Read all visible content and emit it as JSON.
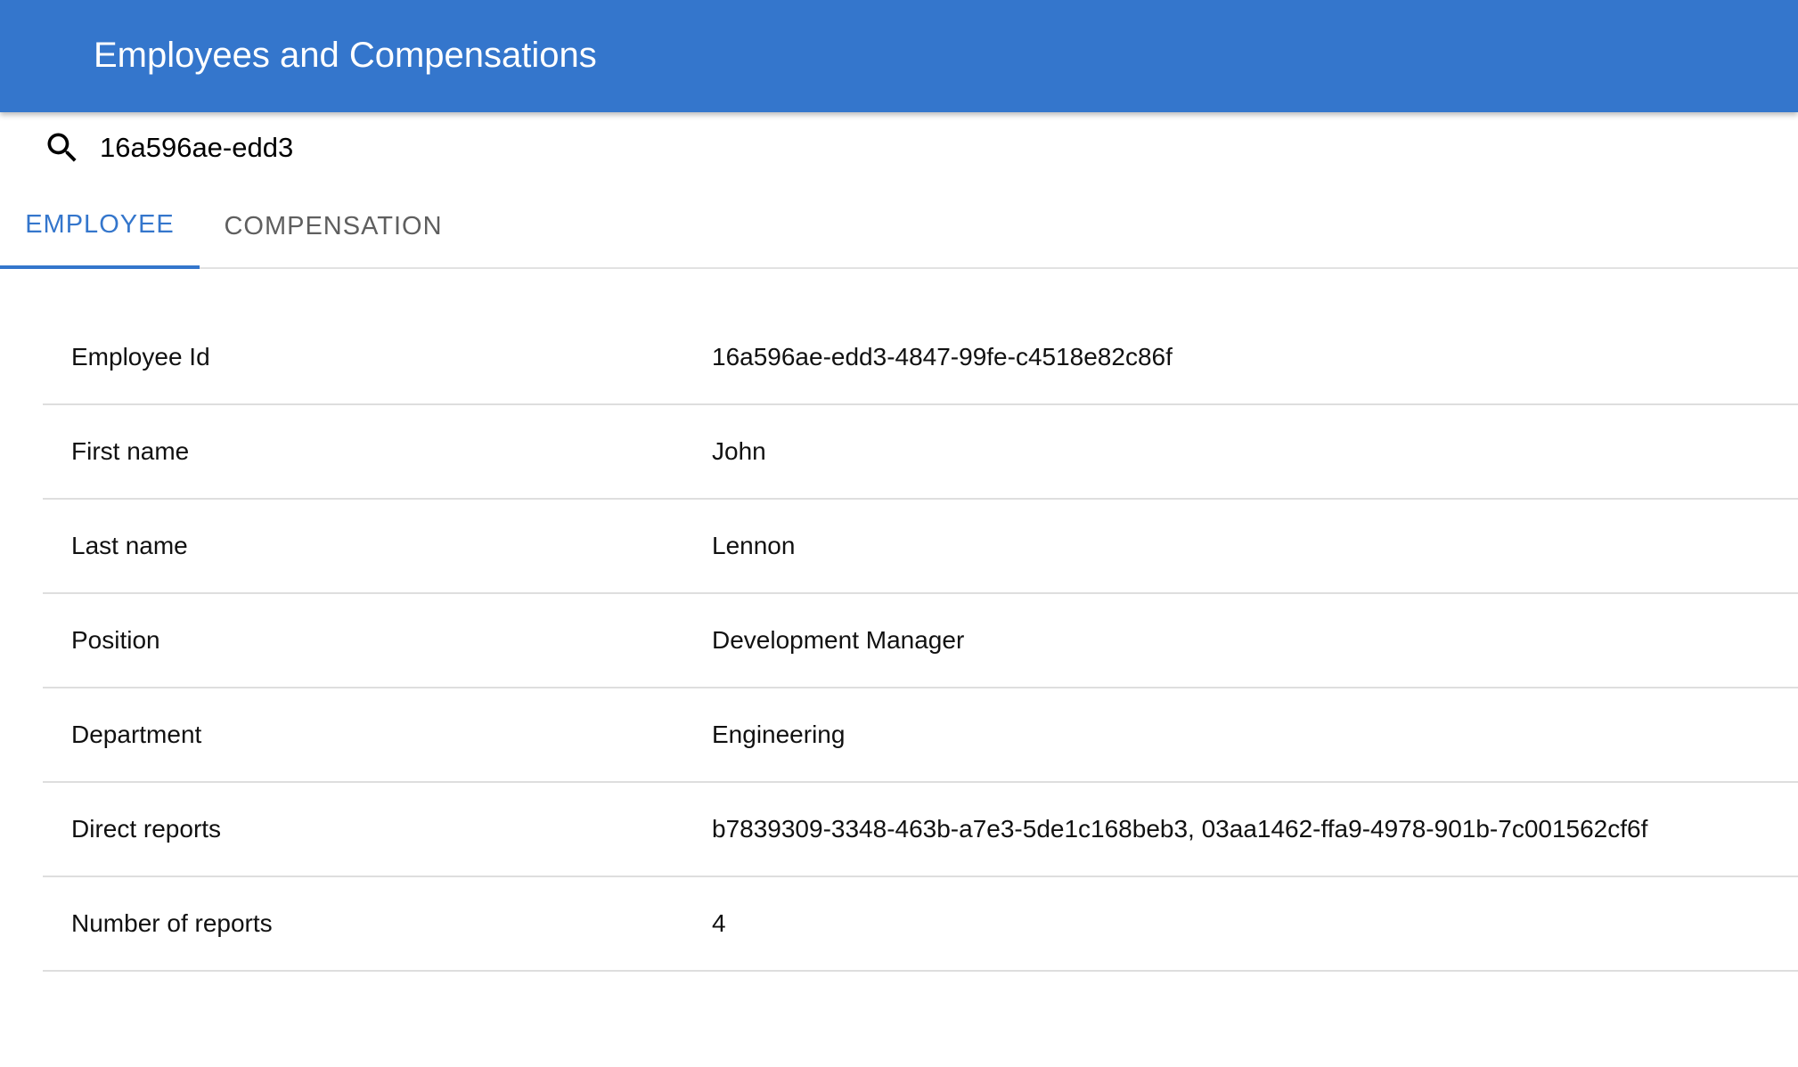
{
  "header": {
    "title": "Employees and Compensations"
  },
  "search": {
    "value": "16a596ae-edd3"
  },
  "tabs": [
    {
      "label": "EMPLOYEE",
      "active": true
    },
    {
      "label": "COMPENSATION",
      "active": false
    }
  ],
  "employee": {
    "rows": [
      {
        "label": "Employee Id",
        "value": "16a596ae-edd3-4847-99fe-c4518e82c86f"
      },
      {
        "label": "First name",
        "value": "John"
      },
      {
        "label": "Last name",
        "value": "Lennon"
      },
      {
        "label": "Position",
        "value": "Development Manager"
      },
      {
        "label": "Department",
        "value": "Engineering"
      },
      {
        "label": "Direct reports",
        "value": "b7839309-3348-463b-a7e3-5de1c168beb3, 03aa1462-ffa9-4978-901b-7c001562cf6f"
      },
      {
        "label": "Number of reports",
        "value": "4"
      }
    ]
  },
  "colors": {
    "primary": "#3476cc",
    "tab_inactive": "#5f5f5f",
    "divider": "#dedede"
  },
  "icons": {
    "search": "search-icon"
  }
}
